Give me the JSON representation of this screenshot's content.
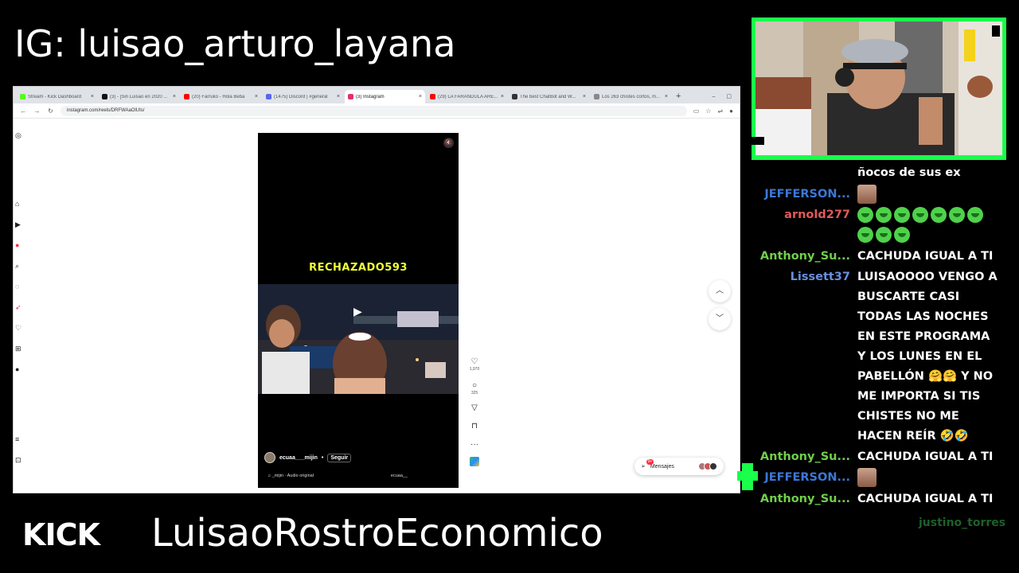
{
  "overlay": {
    "ig_handle": "IG: luisao_arturo_layana",
    "channel_name": "LuisaoRostroEconomico",
    "kick_logo_text": "KICK",
    "accent_color": "#19ff4a"
  },
  "browser": {
    "tabs": [
      {
        "label": "Stream - Kick Dashboard",
        "icon": "kick-icon",
        "color": "#53fc18",
        "active": false
      },
      {
        "label": "(3) - [Sin Luisao en 2020 ...",
        "icon": "tiktok-icon",
        "color": "#111111",
        "active": false
      },
      {
        "label": "(20) Farruko - Hola Beba",
        "icon": "youtube-icon",
        "color": "#ff0000",
        "active": false
      },
      {
        "label": "(1475) Discord | #general",
        "icon": "discord-icon",
        "color": "#5865f2",
        "active": false
      },
      {
        "label": "(3) Instagram",
        "icon": "instagram-icon",
        "color": "#e1306c",
        "active": true
      },
      {
        "label": "(29) LA FARANDULA ARE...",
        "icon": "youtube-icon",
        "color": "#ff0000",
        "active": false
      },
      {
        "label": "The best ChatBot and W...",
        "icon": "github-icon",
        "color": "#333333",
        "active": false
      },
      {
        "label": "Los 263 chistes cortos, m...",
        "icon": "web-icon",
        "color": "#888888",
        "active": false
      }
    ],
    "url": "instagram.com/reels/DRFWAaOlUIs/"
  },
  "reel": {
    "caption": "RECHAZADO593",
    "author": "ecuaa___mijin",
    "follow_label": "Seguir",
    "audio": "♫ _mijin · Audio original",
    "audio_user": "ecuaa__",
    "like_count": "1,970",
    "comment_count": "325"
  },
  "messages_pill": {
    "label": "Mensajes",
    "badge": "9+"
  },
  "chat": {
    "messages": [
      {
        "user": "",
        "user_color": "#ffffff",
        "text": "ñocos de sus ex"
      },
      {
        "user": "JEFFERSON...",
        "user_color": "#3a78d8",
        "text": ""
      },
      {
        "user": "arnold277",
        "user_color": "#e05a5a",
        "text": ""
      },
      {
        "user": "Anthony_Su...",
        "user_color": "#6fcf4a",
        "text": "CACHUDA IGUAL A TI"
      },
      {
        "user": "Lissett37",
        "user_color": "#6a8fe0",
        "text": "LUISAOOOO VENGO A BUSCARTE CASI TODAS LAS NOCHES EN ESTE PROGRAMA Y LOS LUNES EN EL PABELLÓN 🤗🤗 Y NO ME IMPORTA SI TIS CHISTES NO ME HACEN REÍR 🤣🤣"
      },
      {
        "user": "Anthony_Su...",
        "user_color": "#6fcf4a",
        "text": "CACHUDA IGUAL A TI"
      },
      {
        "user": "JEFFERSON...",
        "user_color": "#3a78d8",
        "text": ""
      },
      {
        "user": "Anthony_Su...",
        "user_color": "#6fcf4a",
        "text": "CACHUDA IGUAL A TI"
      }
    ],
    "lurker": "justino_torres"
  }
}
